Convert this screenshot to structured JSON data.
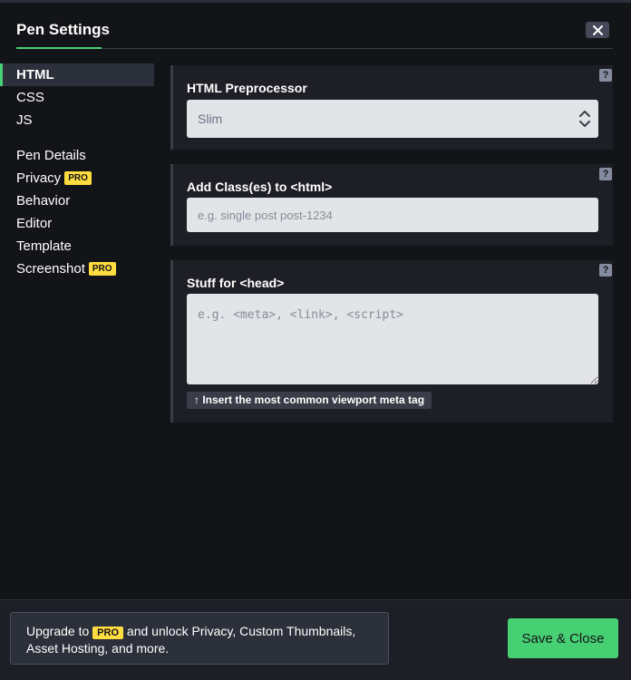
{
  "header": {
    "title": "Pen Settings",
    "close_icon": "close-icon"
  },
  "sidebar": {
    "items": [
      {
        "label": "HTML",
        "active": true
      },
      {
        "label": "CSS"
      },
      {
        "label": "JS"
      },
      {
        "label": "Pen Details"
      },
      {
        "label": "Privacy",
        "badge": "PRO"
      },
      {
        "label": "Behavior"
      },
      {
        "label": "Editor"
      },
      {
        "label": "Template"
      },
      {
        "label": "Screenshot",
        "badge": "PRO"
      }
    ]
  },
  "main": {
    "help_symbol": "?",
    "preprocessor": {
      "label": "HTML Preprocessor",
      "value": "Slim"
    },
    "classes": {
      "label": "Add Class(es) to <html>",
      "placeholder": "e.g. single post post-1234"
    },
    "head": {
      "label": "Stuff for <head>",
      "placeholder": "e.g. <meta>, <link>, <script>",
      "insert_label": "↑ Insert the most common viewport meta tag"
    }
  },
  "footer": {
    "upgrade_prefix": "Upgrade to",
    "upgrade_badge": "PRO",
    "upgrade_suffix": "and unlock Privacy, Custom Thumbnails,",
    "upgrade_line2": "Asset Hosting, and more.",
    "save_label": "Save & Close"
  },
  "colors": {
    "accent": "#47cf73",
    "pro": "#ffdd40",
    "background": "#131417",
    "panel": "#1e1f26"
  }
}
